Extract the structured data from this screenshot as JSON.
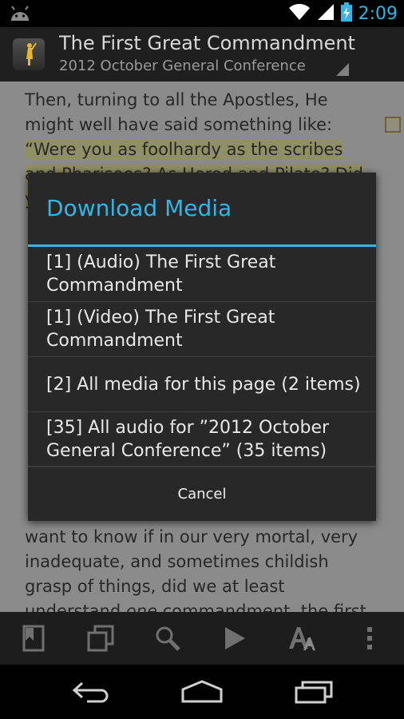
{
  "status_bar": {
    "time": "2:09",
    "icons": [
      "android-icon",
      "wifi-icon",
      "signal-icon",
      "battery-charging-icon"
    ]
  },
  "action_bar": {
    "title": "The First Great Commandment",
    "subtitle": "2012 October General Conference",
    "app_icon": "angel-moroni-icon"
  },
  "content": {
    "paragraph_1": "Then, turning to all the Apostles, He might well have said something like: “Were you as foolhardy as the scribes and Pharisees? As Herod and Pilate? Did you, like they, think",
    "paragraph_end": "want to know if in our very mortal, very inadequate, and sometimes childish grasp of things, did we at least understand ",
    "emphasis": "one",
    "paragraph_end_tail": " commandment, the first and greatest"
  },
  "dialog": {
    "title": "Download Media",
    "items": [
      "[1] (Audio) The First Great Commandment",
      "[1] (Video) The First Great Commandment",
      "[2] All media for this page (2 items)",
      "[35] All audio for ”2012 October General Conference” (35 items)"
    ],
    "cancel_label": "Cancel"
  },
  "toolbar": {
    "items": [
      "bookmark-icon",
      "copy-icon",
      "search-icon",
      "play-icon",
      "text-size-icon",
      "overflow-menu-icon"
    ]
  },
  "nav_bar": {
    "items": [
      "back-icon",
      "home-icon",
      "recents-icon"
    ]
  },
  "colors": {
    "accent": "#33b5e5",
    "highlight": "#ebe7a3",
    "page_bg": "#e0e0e0",
    "dialog_bg": "#282828"
  }
}
